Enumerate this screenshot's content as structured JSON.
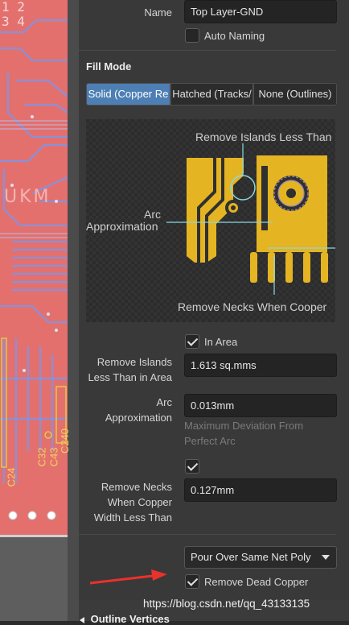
{
  "properties": {
    "name_label": "Name",
    "name_value": "Top Layer-GND",
    "auto_naming_label": "Auto Naming",
    "auto_naming_checked": false
  },
  "fill_mode": {
    "title": "Fill Mode",
    "options": [
      {
        "label": "Solid (Copper Re",
        "active": true
      },
      {
        "label": "Hatched (Tracks/",
        "active": false
      },
      {
        "label": "None (Outlines)",
        "active": false
      }
    ]
  },
  "illustration": {
    "remove_islands_caption": "Remove Islands Less Than",
    "arc_caption_line1": "Arc",
    "arc_caption_line2": "Approximation",
    "remove_necks_caption": "Remove Necks When Cooper"
  },
  "settings": {
    "in_area_label": "In Area",
    "in_area_checked": true,
    "remove_islands_label_line1": "Remove Islands",
    "remove_islands_label_line2": "Less Than in Area",
    "remove_islands_value": "1.613 sq.mms",
    "arc_label_line1": "Arc",
    "arc_label_line2": "Approximation",
    "arc_value": "0.013mm",
    "arc_hint_line1": "Maximum Deviation From",
    "arc_hint_line2": "Perfect Arc",
    "necks_checked": true,
    "necks_label_line1": "Remove Necks",
    "necks_label_line2": "When Copper",
    "necks_label_line3": "Width Less Than",
    "necks_value": "0.127mm"
  },
  "pour": {
    "pour_over_selected": "Pour Over Same Net Poly",
    "remove_dead_copper_label": "Remove Dead Copper",
    "remove_dead_copper_checked": true
  },
  "pcb_labels": {
    "ukm": "UKM",
    "c32": "C32",
    "c43": "C43",
    "c240": "C240",
    "c24": "C24",
    "top_digits": "1 2\n3 4"
  },
  "watermark": "https://blog.csdn.net/qq_43133135",
  "outline_vertices_header": "Outline Vertices",
  "colors": {
    "panel_bg": "#393939",
    "accent_blue": "#4d7fb5",
    "copper_yellow": "#e5b422",
    "pcb_red": "#e8706f",
    "trace_blue": "#8a90d8",
    "arrow_red": "#e8322c"
  }
}
